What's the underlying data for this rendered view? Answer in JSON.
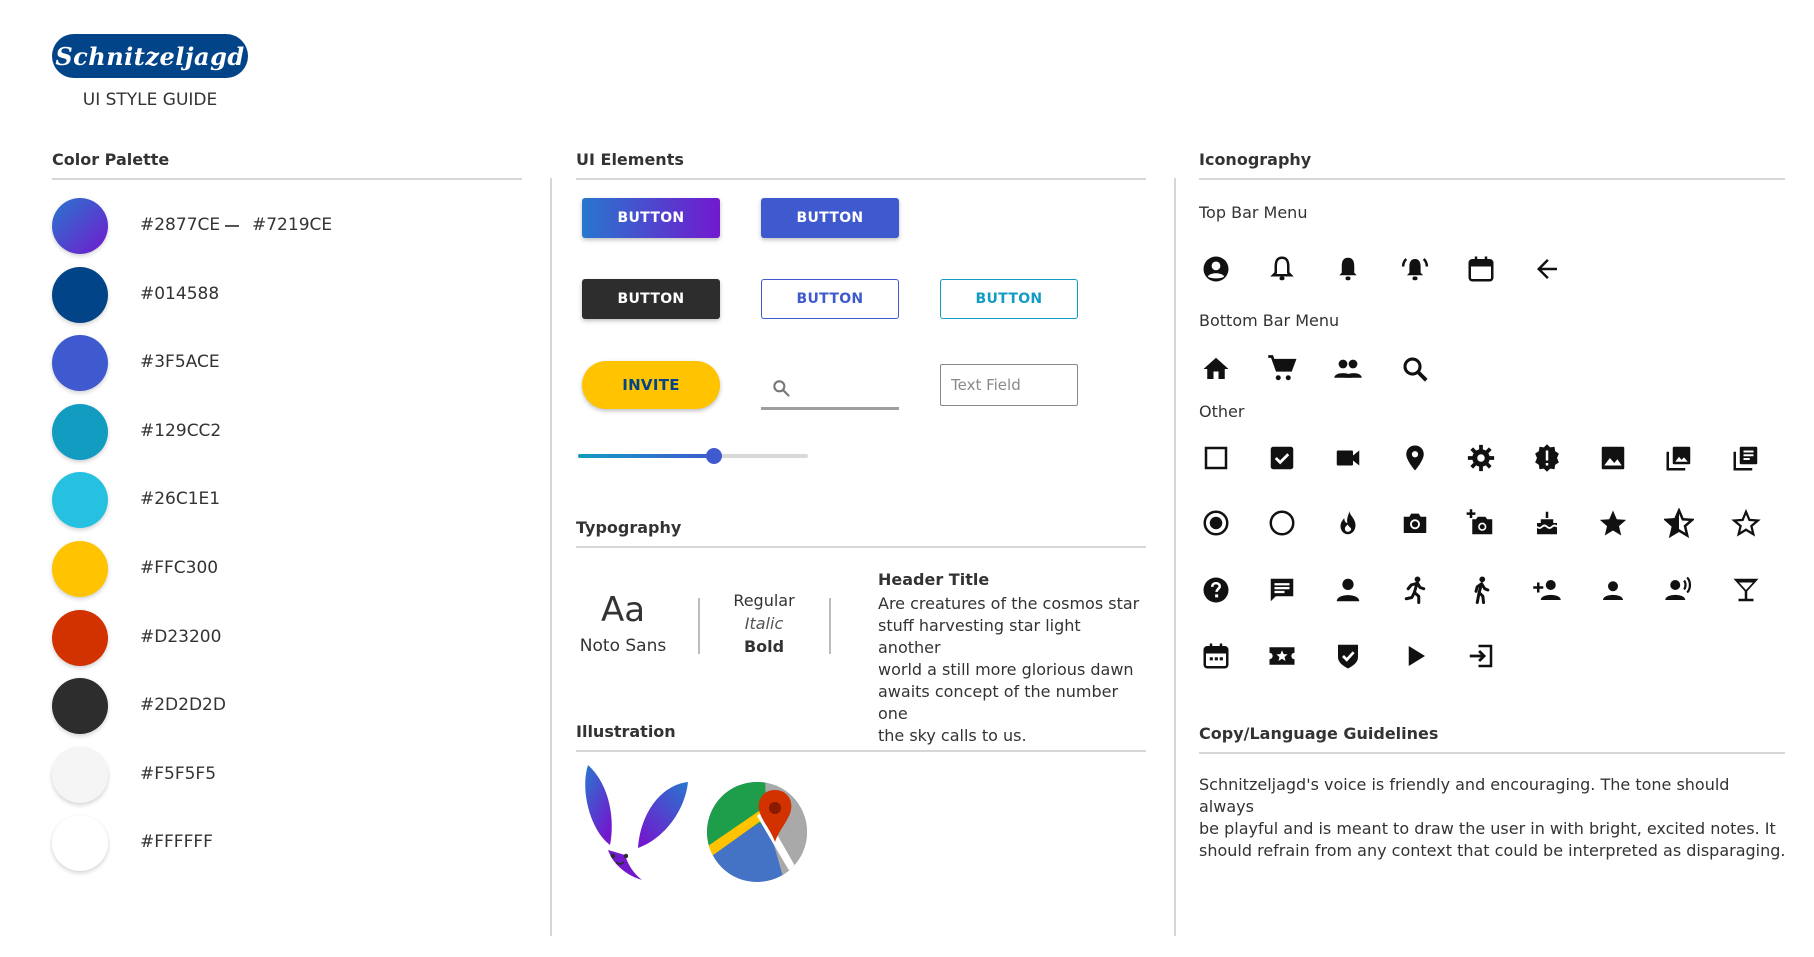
{
  "header": {
    "logo_text": "Schnitzeljagd",
    "subtitle": "UI STYLE GUIDE"
  },
  "color_palette": {
    "title": "Color Palette",
    "swatches": [
      {
        "label": "#2877CE",
        "label2": "#7219CE",
        "gradient": [
          "#2877CE",
          "#7219CE"
        ]
      },
      {
        "label": "#014588",
        "color": "#014588"
      },
      {
        "label": "#3F5ACE",
        "color": "#3F5ACE"
      },
      {
        "label": "#129CC2",
        "color": "#129CC2"
      },
      {
        "label": "#26C1E1",
        "color": "#26C1E1"
      },
      {
        "label": "#FFC300",
        "color": "#FFC300"
      },
      {
        "label": "#D23200",
        "color": "#D23200"
      },
      {
        "label": "#2D2D2D",
        "color": "#2D2D2D"
      },
      {
        "label": "#F5F5F5",
        "color": "#F5F5F5"
      },
      {
        "label": "#FFFFFF",
        "color": "#FFFFFF"
      }
    ]
  },
  "ui_elements": {
    "title": "UI Elements",
    "buttons": {
      "gradient": "BUTTON",
      "solid_blue": "BUTTON",
      "dark": "BUTTON",
      "outline_blue": "BUTTON",
      "outline_teal": "BUTTON",
      "invite": "INVITE"
    },
    "text_field_placeholder": "Text Field",
    "slider_value": 0.59
  },
  "typography": {
    "title": "Typography",
    "sample": "Aa",
    "font_name": "Noto Sans",
    "weights": [
      "Regular",
      "Italic",
      "Bold"
    ],
    "header_title": "Header Title",
    "body_lines": [
      "Are creatures of the cosmos star",
      "stuff harvesting star light another",
      "world a still more glorious dawn",
      "awaits concept of the number one",
      "the sky calls to us."
    ]
  },
  "illustration": {
    "title": "Illustration"
  },
  "iconography": {
    "title": "Iconography",
    "top_bar_label": "Top Bar Menu",
    "bottom_bar_label": "Bottom Bar Menu",
    "other_label": "Other",
    "top_bar_icons": [
      "account-circle-icon",
      "bell-outline-icon",
      "bell-icon",
      "bell-ringing-icon",
      "calendar-icon",
      "arrow-back-icon"
    ],
    "bottom_bar_icons": [
      "home-icon",
      "cart-icon",
      "people-icon",
      "search-icon"
    ],
    "other_icons": [
      [
        "checkbox-empty-icon",
        "checkbox-checked-icon",
        "videocam-icon",
        "location-pin-icon",
        "settings-icon",
        "alert-badge-icon",
        "image-icon",
        "photo-library-icon",
        "library-books-icon"
      ],
      [
        "radio-checked-icon",
        "radio-empty-icon",
        "flame-icon",
        "camera-icon",
        "add-camera-icon",
        "cake-icon",
        "star-icon",
        "star-half-icon",
        "star-outline-icon"
      ],
      [
        "help-icon",
        "chat-icon",
        "person-icon",
        "running-icon",
        "walking-icon",
        "add-person-icon",
        "person-small-icon",
        "voice-person-icon",
        "cocktail-icon"
      ],
      [
        "event-icon",
        "ticket-star-icon",
        "shield-check-icon",
        "play-icon",
        "login-icon"
      ]
    ]
  },
  "copy_guidelines": {
    "title": "Copy/Language Guidelines",
    "lines": [
      "Schnitzeljagd's voice is friendly and encouraging. The tone should always",
      "be playful and is meant to draw the user in with bright, excited notes. It",
      "should refrain from any context that could be interpreted as disparaging."
    ]
  }
}
